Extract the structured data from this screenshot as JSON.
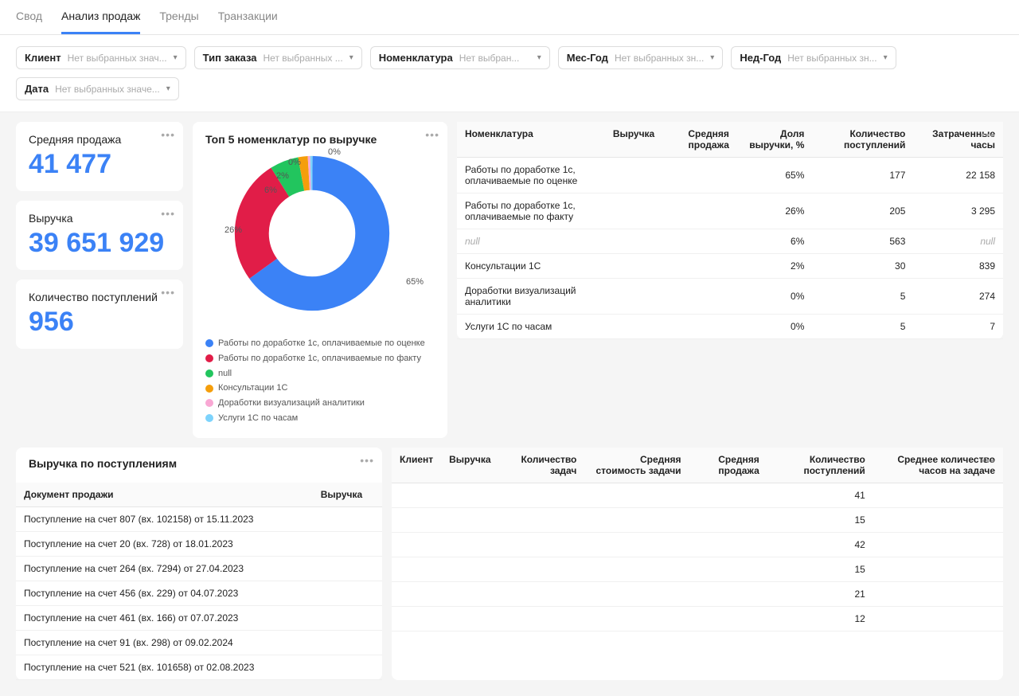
{
  "tabs": [
    "Свод",
    "Анализ продаж",
    "Тренды",
    "Транзакции"
  ],
  "activeTab": 1,
  "filters": [
    {
      "label": "Клиент",
      "placeholder": "Нет выбранных знач..."
    },
    {
      "label": "Тип заказа",
      "placeholder": "Нет выбранных ..."
    },
    {
      "label": "Номенклатура",
      "placeholder": "Нет выбран..."
    },
    {
      "label": "Мес-Год",
      "placeholder": "Нет выбранных зн..."
    },
    {
      "label": "Нед-Год",
      "placeholder": "Нет выбранных зн..."
    },
    {
      "label": "Дата",
      "placeholder": "Нет выбранных значе..."
    }
  ],
  "kpis": [
    {
      "label": "Средняя продажа",
      "value": "41 477"
    },
    {
      "label": "Выручка",
      "value": "39 651 929"
    },
    {
      "label": "Количество поступлений",
      "value": "956"
    }
  ],
  "donut": {
    "title": "Топ 5 номенклатур по выручке",
    "labels": [
      "65%",
      "26%",
      "6%",
      "2%",
      "0%",
      "0%"
    ]
  },
  "legend": [
    {
      "color": "#3b82f6",
      "text": "Работы по доработке 1с, оплачиваемые по оценке"
    },
    {
      "color": "#e11d48",
      "text": "Работы по доработке 1с, оплачиваемые по факту"
    },
    {
      "color": "#22c55e",
      "text": "null"
    },
    {
      "color": "#f59e0b",
      "text": "Консультации 1С"
    },
    {
      "color": "#f9a8d4",
      "text": "Доработки визуализаций аналитики"
    },
    {
      "color": "#7dd3fc",
      "text": "Услуги 1С по часам"
    }
  ],
  "chart_data": {
    "type": "pie",
    "title": "Топ 5 номенклатур по выручке",
    "series": [
      {
        "name": "Работы по доработке 1с, оплачиваемые по оценке",
        "value": 65,
        "color": "#3b82f6"
      },
      {
        "name": "Работы по доработке 1с, оплачиваемые по факту",
        "value": 26,
        "color": "#e11d48"
      },
      {
        "name": "null",
        "value": 6,
        "color": "#22c55e"
      },
      {
        "name": "Консультации 1С",
        "value": 2,
        "color": "#f59e0b"
      },
      {
        "name": "Доработки визуализаций аналитики",
        "value": 0,
        "color": "#f9a8d4"
      },
      {
        "name": "Услуги 1С по часам",
        "value": 0,
        "color": "#7dd3fc"
      }
    ]
  },
  "topTable": {
    "headers": [
      "Номенклатура",
      "Выручка",
      "Средняя продажа",
      "Доля выручки, %",
      "Количество поступлений",
      "Затраченные часы"
    ],
    "rows": [
      {
        "c0": "Работы по доработке 1с, оплачиваемые по оценке",
        "c3": "65%",
        "c4": "177",
        "c5": "22 158"
      },
      {
        "c0": "Работы по доработке 1с, оплачиваемые по факту",
        "c3": "26%",
        "c4": "205",
        "c5": "3 295"
      },
      {
        "c0": "null",
        "null": true,
        "c3": "6%",
        "c4": "563",
        "c5": "null"
      },
      {
        "c0": "Консультации 1С",
        "c3": "2%",
        "c4": "30",
        "c5": "839"
      },
      {
        "c0": "Доработки визуализаций аналитики",
        "c3": "0%",
        "c4": "5",
        "c5": "274"
      },
      {
        "c0": "Услуги 1С по часам",
        "c3": "0%",
        "c4": "5",
        "c5": "7"
      }
    ]
  },
  "revenue": {
    "title": "Выручка по поступлениям",
    "headers": [
      "Документ продажи",
      "Выручка"
    ],
    "rows": [
      "Поступление на счет 807 (вх. 102158) от 15.11.2023",
      "Поступление на счет 20 (вх. 728) от 18.01.2023",
      "Поступление на счет 264 (вх. 7294) от 27.04.2023",
      "Поступление на счет 456 (вх. 229) от 04.07.2023",
      "Поступление на счет 461 (вх. 166) от 07.07.2023",
      "Поступление на счет 91 (вх. 298) от 09.02.2024",
      "Поступление на счет 521 (вх. 101658) от 02.08.2023"
    ]
  },
  "clients": {
    "headers": [
      "Клиент",
      "Выручка",
      "Количество задач",
      "Средняя стоимость задачи",
      "Средняя продажа",
      "Количество поступлений",
      "Среднее количество часов на задаче"
    ],
    "counts": [
      "41",
      "15",
      "42",
      "15",
      "21",
      "12"
    ]
  }
}
